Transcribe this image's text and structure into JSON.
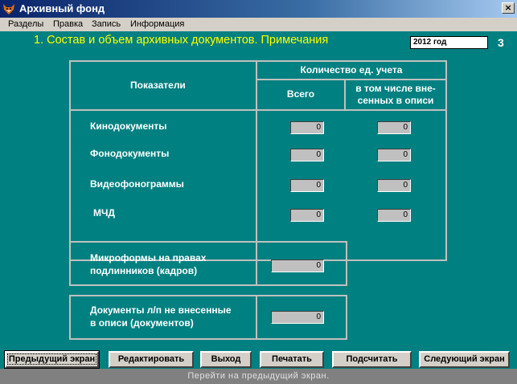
{
  "window": {
    "title": "Архивный фонд",
    "close_glyph": "×"
  },
  "menu": [
    "Разделы",
    "Правка",
    "Запись",
    "Информация"
  ],
  "heading": {
    "number": "1.",
    "text": "Состав и объем архивных документов. Примечания"
  },
  "year": "2012 год",
  "page_number": "3",
  "table": {
    "row_header": "Показатели",
    "group_header": "Количество ед. учета",
    "col_total": "Всего",
    "col_included_line1": "в том числе вне-",
    "col_included_line2": "сенных в описи",
    "rows": [
      {
        "label": "Кинодокументы",
        "total": "0",
        "included": "0"
      },
      {
        "label": "Фонодокументы",
        "total": "0",
        "included": "0"
      },
      {
        "label": "Видеофонограммы",
        "total": "0",
        "included": "0"
      },
      {
        "label": "МЧД",
        "total": "0",
        "included": "0"
      }
    ]
  },
  "microforms": {
    "line1": "Микроформы на правах",
    "line2": "подлинников (кадров)",
    "value": "0"
  },
  "not_included": {
    "line1": "Документы л/п не внесенные",
    "line2": "в описи (документов)",
    "value": "0"
  },
  "buttons": {
    "prev": "Предыдущий экран",
    "edit": "Редактировать",
    "exit": "Выход",
    "print": "Печатать",
    "calc": "Подсчитать",
    "next": "Следующий экран"
  },
  "status": "Перейти на предыдущий экран."
}
